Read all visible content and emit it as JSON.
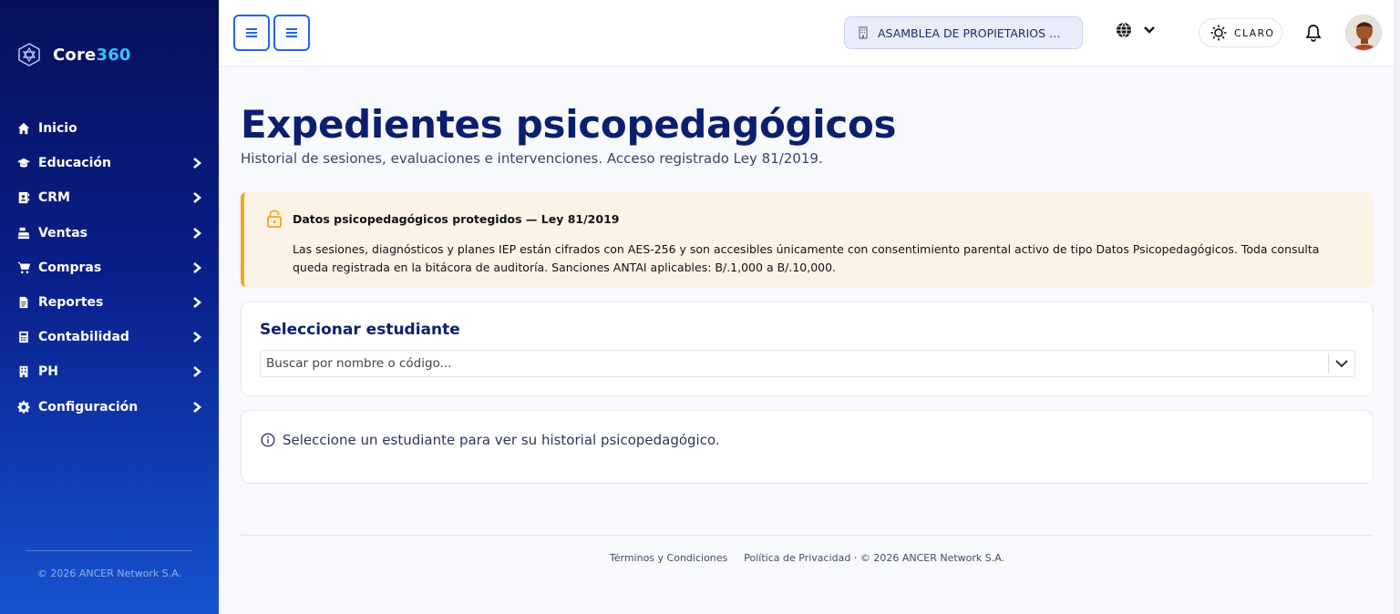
{
  "brand": {
    "name_prefix": "Core",
    "name_accent": "360"
  },
  "sidebar": {
    "items": [
      {
        "label": "Inicio",
        "icon": "home-icon",
        "has_children": false
      },
      {
        "label": "Educación",
        "icon": "graduation-cap-icon",
        "has_children": true
      },
      {
        "label": "CRM",
        "icon": "contact-book-icon",
        "has_children": true
      },
      {
        "label": "Ventas",
        "icon": "cash-register-icon",
        "has_children": true
      },
      {
        "label": "Compras",
        "icon": "shopping-cart-icon",
        "has_children": true
      },
      {
        "label": "Reportes",
        "icon": "report-file-icon",
        "has_children": true
      },
      {
        "label": "Contabilidad",
        "icon": "calculator-icon",
        "has_children": true
      },
      {
        "label": "PH",
        "icon": "building-icon",
        "has_children": true
      },
      {
        "label": "Configuración",
        "icon": "gear-icon",
        "has_children": true
      }
    ],
    "footer": "© 2026 ANCER Network S.A."
  },
  "topbar": {
    "organization": "ASAMBLEA DE PROPIETARIOS DE ...",
    "theme_label": "CLARO"
  },
  "main": {
    "title": "Expedientes psicopedagógicos",
    "subtitle": "Historial de sesiones, evaluaciones e intervenciones. Acceso registrado Ley 81/2019.",
    "alert": {
      "title": "Datos psicopedagógicos protegidos — Ley 81/2019",
      "body": "Las sesiones, diagnósticos y planes IEP están cifrados con AES-256 y son accesibles únicamente con consentimiento parental activo de tipo Datos Psicopedagógicos. Toda consulta queda registrada en la bitácora de auditoría. Sanciones ANTAI aplicables: B/.1,000 a B/.10,000."
    },
    "student_card": {
      "title": "Seleccionar estudiante",
      "placeholder": "Buscar por nombre o código..."
    },
    "info_message": "Seleccione un estudiante para ver su historial psicopedagógico."
  },
  "footer": {
    "terms": "Términos y Condiciones",
    "privacy": "Política de Privacidad",
    "copyright": "· © 2026 ANCER Network S.A."
  },
  "colors": {
    "primary": "#2563eb",
    "title": "#0b1f6e",
    "warning": "#f5a524",
    "accent": "#36c3ff"
  }
}
